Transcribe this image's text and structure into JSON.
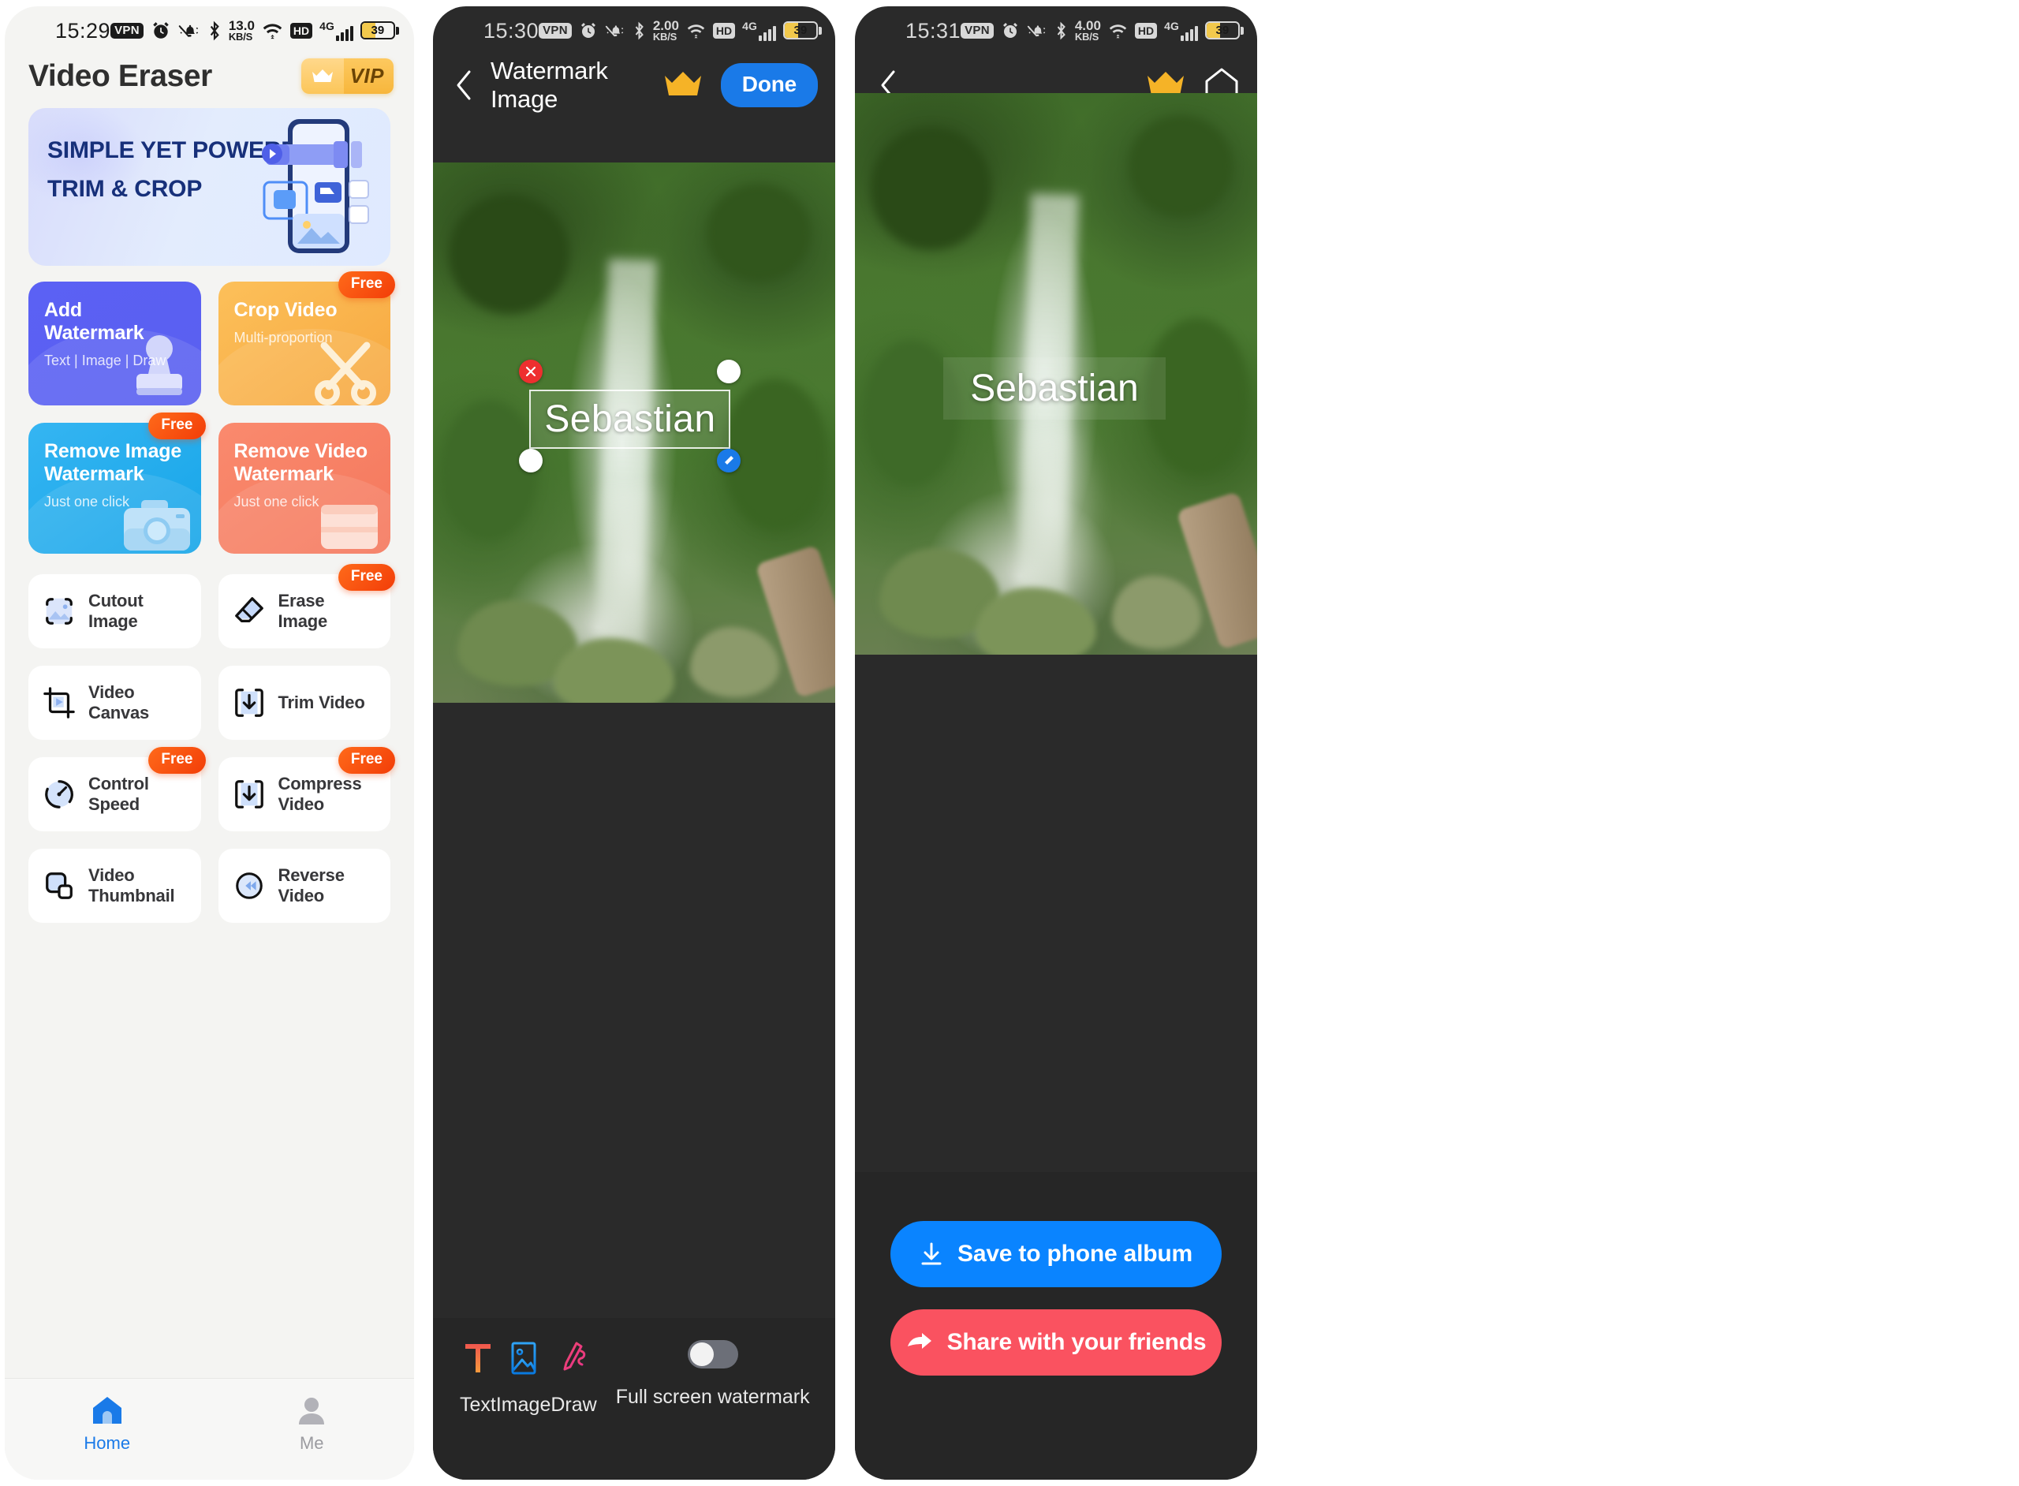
{
  "panels": {
    "home": {
      "status": {
        "time": "15:29",
        "vpn": "VPN",
        "net_speed": "13.0",
        "net_speed_unit": "KB/S",
        "hd": "HD",
        "gen": "4G",
        "battery": "39"
      },
      "app_title": "Video Eraser",
      "vip_label": "VIP",
      "hero": {
        "line1": "SIMPLE YET POWERFUL",
        "line2": "TRIM & CROP"
      },
      "cards": [
        {
          "title": "Add Watermark",
          "subtitle": "Text | Image | Draw",
          "badge": "",
          "icon": "stamp-icon"
        },
        {
          "title": "Crop Video",
          "subtitle": "Multi-proportion",
          "badge": "Free",
          "icon": "scissors-icon"
        },
        {
          "title": "Remove Image Watermark",
          "subtitle": "Just one click",
          "badge": "Free",
          "icon": "camera-icon"
        },
        {
          "title": "Remove Video Watermark",
          "subtitle": "Just one click",
          "badge": "",
          "icon": "filmstrip-icon"
        }
      ],
      "rows": [
        {
          "label": "Cutout Image",
          "badge": "",
          "icon": "image-cutout-icon"
        },
        {
          "label": "Erase Image",
          "badge": "Free",
          "icon": "eraser-icon"
        },
        {
          "label": "Video Canvas",
          "badge": "",
          "icon": "crop-play-icon"
        },
        {
          "label": "Trim Video",
          "badge": "",
          "icon": "download-bracket-icon"
        },
        {
          "label": "Control Speed",
          "badge": "Free",
          "icon": "speedometer-icon"
        },
        {
          "label": "Compress Video",
          "badge": "Free",
          "icon": "compress-icon"
        },
        {
          "label": "Video Thumbnail",
          "badge": "",
          "icon": "thumbnail-icon"
        },
        {
          "label": "Reverse Video",
          "badge": "",
          "icon": "reverse-icon"
        }
      ],
      "tabs": [
        {
          "label": "Home",
          "icon": "home-icon",
          "active": true
        },
        {
          "label": "Me",
          "icon": "person-icon",
          "active": false
        }
      ]
    },
    "editor": {
      "status": {
        "time": "15:30",
        "vpn": "VPN",
        "net_speed": "2.00",
        "net_speed_unit": "KB/S",
        "hd": "HD",
        "gen": "4G",
        "battery": "39"
      },
      "nav": {
        "title": "Watermark Image",
        "back": "back-icon",
        "crown": "crown-icon",
        "done": "Done"
      },
      "watermark_text": "Sebastian",
      "tools": [
        {
          "label": "Text",
          "icon": "text-t-icon"
        },
        {
          "label": "Image",
          "icon": "picture-icon"
        },
        {
          "label": "Draw",
          "icon": "pen-icon"
        }
      ],
      "full_screen_watermark": {
        "label": "Full screen watermark",
        "on": false
      }
    },
    "result": {
      "status": {
        "time": "15:31",
        "vpn": "VPN",
        "net_speed": "4.00",
        "net_speed_unit": "KB/S",
        "hd": "HD",
        "gen": "4G",
        "battery": "39"
      },
      "nav": {
        "back": "back-icon",
        "crown": "crown-icon",
        "home": "home-outline-icon"
      },
      "watermark_text": "Sebastian",
      "buttons": [
        {
          "label": "Save to phone album",
          "icon": "download-icon",
          "color": "#0a84ff"
        },
        {
          "label": "Share with your friends",
          "icon": "share-icon",
          "color": "#fa5260"
        }
      ]
    }
  },
  "colors": {
    "accent_blue": "#1a7ae8",
    "free_badge": "#f2490a",
    "vip_gold": "#f7b63c",
    "share_red": "#fa5260"
  }
}
